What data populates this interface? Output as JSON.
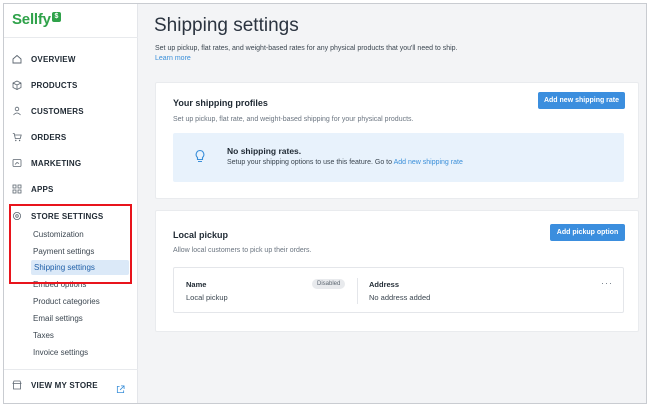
{
  "logo": {
    "text": "Sellfy",
    "badge": "$"
  },
  "sidebar": {
    "items": [
      {
        "label": "OVERVIEW",
        "icon": "home-icon"
      },
      {
        "label": "PRODUCTS",
        "icon": "box-icon"
      },
      {
        "label": "CUSTOMERS",
        "icon": "users-icon"
      },
      {
        "label": "ORDERS",
        "icon": "cart-icon"
      },
      {
        "label": "MARKETING",
        "icon": "megaphone-icon"
      },
      {
        "label": "APPS",
        "icon": "grid-icon"
      },
      {
        "label": "STORE SETTINGS",
        "icon": "gear-icon"
      }
    ],
    "sub_items": [
      "Customization",
      "Payment settings",
      "Shipping settings",
      "Embed options",
      "Product categories",
      "Email settings",
      "Taxes",
      "Invoice settings"
    ],
    "active_sub_item": "Shipping settings",
    "view_store": "VIEW MY STORE"
  },
  "main": {
    "title": "Shipping settings",
    "description": "Set up pickup, flat rates, and weight-based rates for any physical products that you'll need to ship.",
    "learn_more": "Learn more",
    "profiles": {
      "title": "Your shipping profiles",
      "subtitle": "Set up pickup, flat rate, and weight-based shipping for your physical products.",
      "button": "Add new shipping rate",
      "empty_title": "No shipping rates.",
      "empty_desc": "Setup your shipping options to use this feature. Go to",
      "empty_link": "Add new shipping rate"
    },
    "pickup": {
      "title": "Local pickup",
      "subtitle": "Allow local customers to pick up their orders.",
      "button": "Add pickup option",
      "name_head": "Name",
      "name_value": "Local pickup",
      "status": "Disabled",
      "address_head": "Address",
      "address_value": "No address added",
      "more": "···"
    }
  },
  "colors": {
    "accent": "#3b8ede",
    "brand": "#2fa24a",
    "highlight": "#e8141c"
  }
}
